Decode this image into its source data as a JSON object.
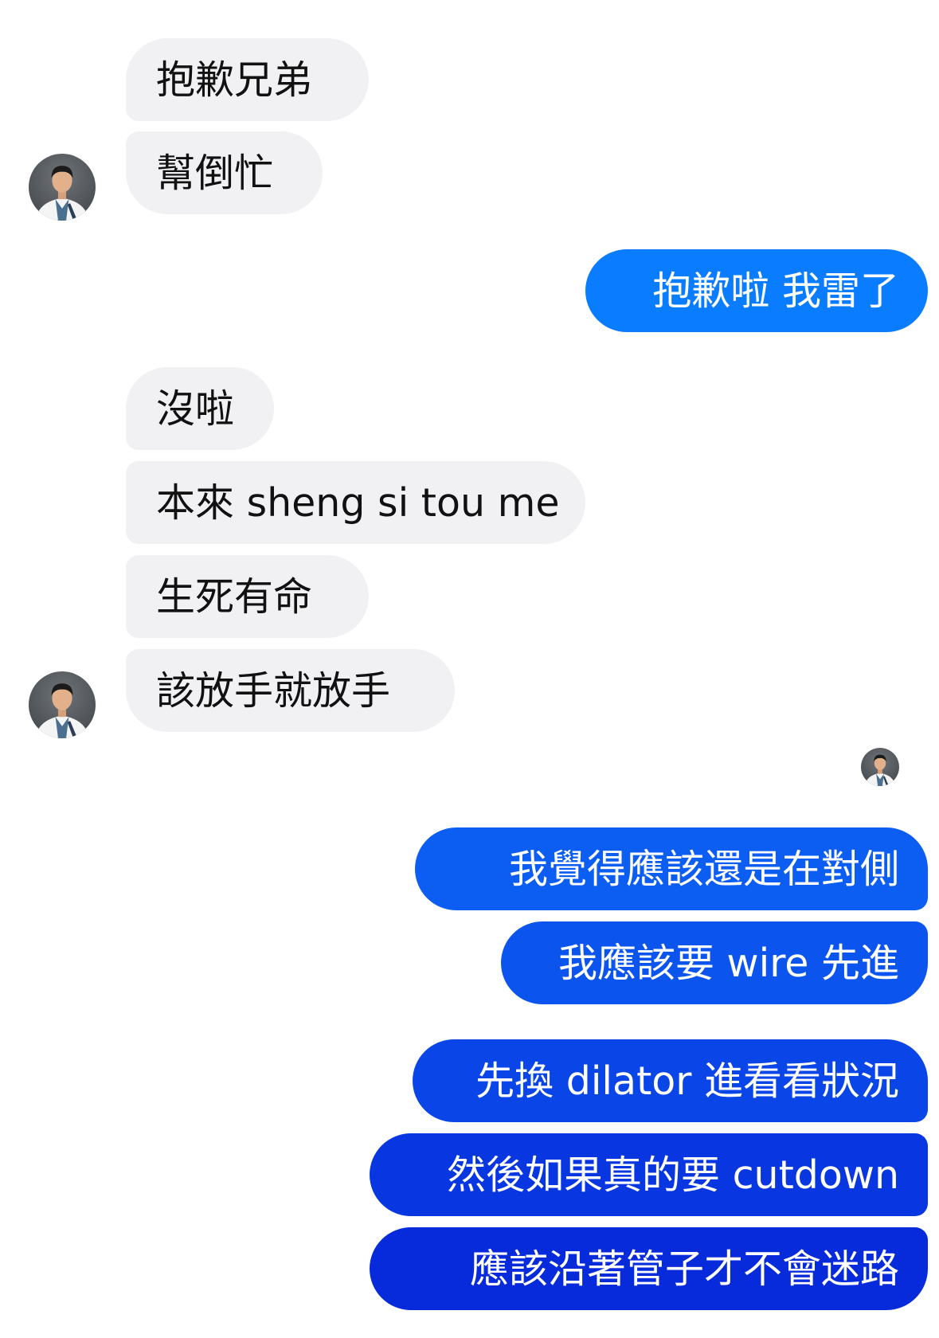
{
  "messages": [
    {
      "id": "m1",
      "from": "them",
      "text": "抱歉兄弟"
    },
    {
      "id": "m2",
      "from": "them",
      "text": "幫倒忙"
    },
    {
      "id": "m3",
      "from": "me",
      "text": "抱歉啦 我雷了"
    },
    {
      "id": "m4",
      "from": "them",
      "text": "沒啦"
    },
    {
      "id": "m5",
      "from": "them",
      "text": "本來 sheng si tou me"
    },
    {
      "id": "m6",
      "from": "them",
      "text": "生死有命"
    },
    {
      "id": "m7",
      "from": "them",
      "text": "該放手就放手"
    },
    {
      "id": "m8",
      "from": "me",
      "text": "我覺得應該還是在對側"
    },
    {
      "id": "m9",
      "from": "me",
      "text": "我應該要 wire 先進"
    },
    {
      "id": "m10",
      "from": "me",
      "text": "先換 dilator 進看看狀況"
    },
    {
      "id": "m11",
      "from": "me",
      "text": "然後如果真的要 cutdown"
    },
    {
      "id": "m12",
      "from": "me",
      "text": "應該沿著管子才不會迷路"
    }
  ],
  "avatars": [
    {
      "icon": "contact-avatar",
      "role": "sender-avatar"
    },
    {
      "icon": "contact-avatar",
      "role": "sender-avatar"
    },
    {
      "icon": "contact-avatar",
      "role": "read-receipt-avatar"
    }
  ],
  "colors": {
    "incoming_bubble": "#f1f1f4",
    "incoming_text": "#111111",
    "outgoing_bubble_top": "#0a7cff",
    "outgoing_bubble_bottom": "#1a2fd9",
    "outgoing_text": "#ffffff"
  }
}
